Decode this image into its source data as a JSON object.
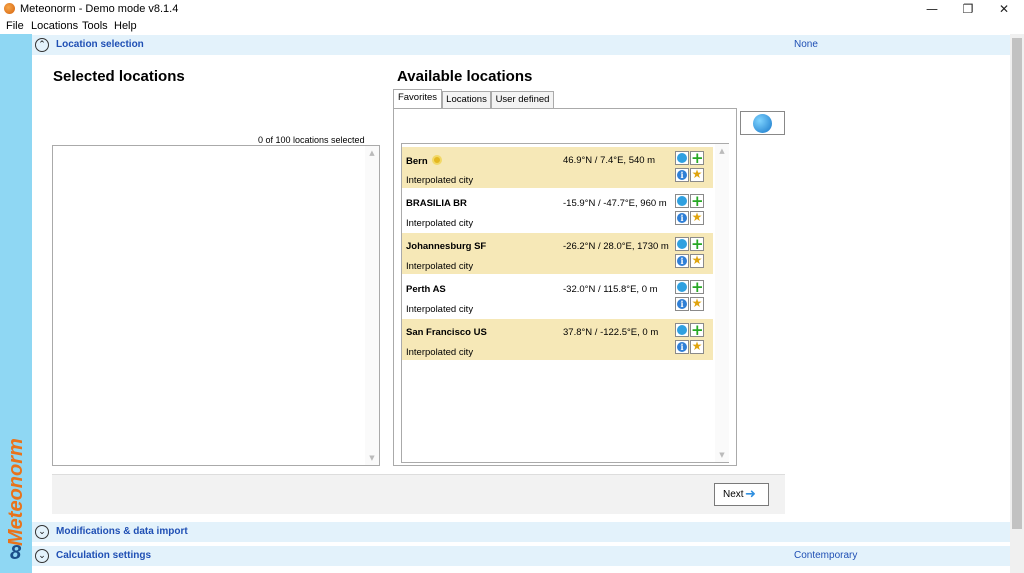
{
  "window": {
    "title": "Meteonorm - Demo mode v8.1.4",
    "minimize": "—",
    "restore": "❐",
    "close": "✕"
  },
  "menu": [
    "File",
    "Locations",
    "Tools",
    "Help"
  ],
  "brand": {
    "name": "Meteonorm",
    "version": "8",
    "name_color": "#e8731b",
    "strip_color": "#8fd7f3"
  },
  "sections": {
    "location_selection": {
      "title": "Location selection",
      "value": "None"
    },
    "modifications": {
      "title": "Modifications & data import",
      "value": ""
    },
    "calculation": {
      "title": "Calculation settings",
      "value": "Contemporary"
    }
  },
  "selected": {
    "heading": "Selected locations",
    "count": "0 of 100 locations selected"
  },
  "available": {
    "heading": "Available locations",
    "tabs": [
      "Favorites",
      "Locations",
      "User defined"
    ],
    "active_tab": "Favorites",
    "locations": [
      {
        "name": "Bern",
        "coords": "46.9°N / 7.4°E, 540 m",
        "type": "Interpolated city",
        "favorite": true,
        "sun": true
      },
      {
        "name": "BRASILIA BR",
        "coords": "-15.9°N / -47.7°E, 960 m",
        "type": "Interpolated city",
        "favorite": false,
        "sun": false
      },
      {
        "name": "Johannesburg SF",
        "coords": "-26.2°N / 28.0°E, 1730 m",
        "type": "Interpolated city",
        "favorite": true,
        "sun": false
      },
      {
        "name": "Perth AS",
        "coords": "-32.0°N / 115.8°E, 0 m",
        "type": "Interpolated city",
        "favorite": false,
        "sun": false
      },
      {
        "name": "San Francisco US",
        "coords": "37.8°N / -122.5°E, 0 m",
        "type": "Interpolated city",
        "favorite": true,
        "sun": false
      }
    ]
  },
  "footer": {
    "next_label": "Next"
  }
}
